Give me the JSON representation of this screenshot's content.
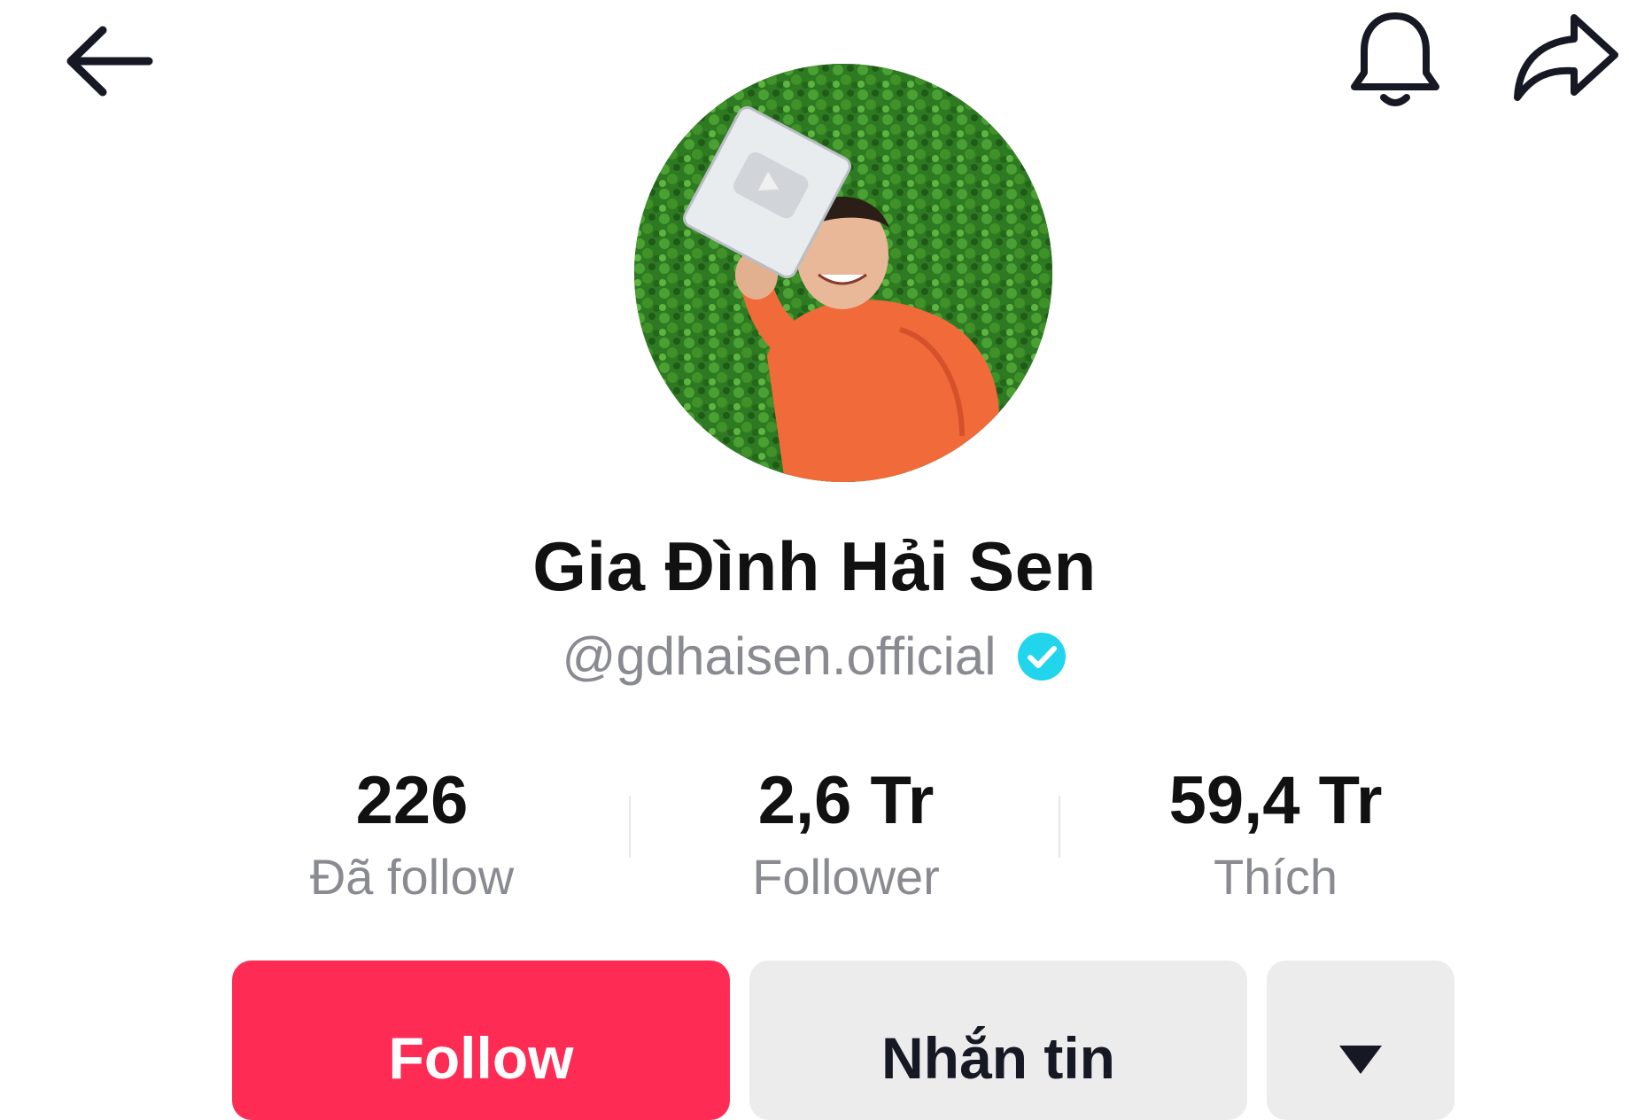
{
  "profile": {
    "display_name": "Gia Đình Hải Sen",
    "handle": "@gdhaisen.official",
    "verified": true
  },
  "stats": {
    "following": {
      "value": "226",
      "label": "Đã follow"
    },
    "followers": {
      "value": "2,6 Tr",
      "label": "Follower"
    },
    "likes": {
      "value": "59,4 Tr",
      "label": "Thích"
    }
  },
  "actions": {
    "follow_label": "Follow",
    "message_label": "Nhắn tin"
  },
  "icons": {
    "back": "arrow-left-icon",
    "notifications": "bell-icon",
    "share": "share-arrow-icon",
    "verified": "verified-check-icon",
    "more": "triangle-down-icon"
  },
  "colors": {
    "follow_button": "#fe2c55",
    "secondary_button": "#ececed",
    "verified_badge": "#20d5ec",
    "secondary_text": "#8a8b91"
  }
}
